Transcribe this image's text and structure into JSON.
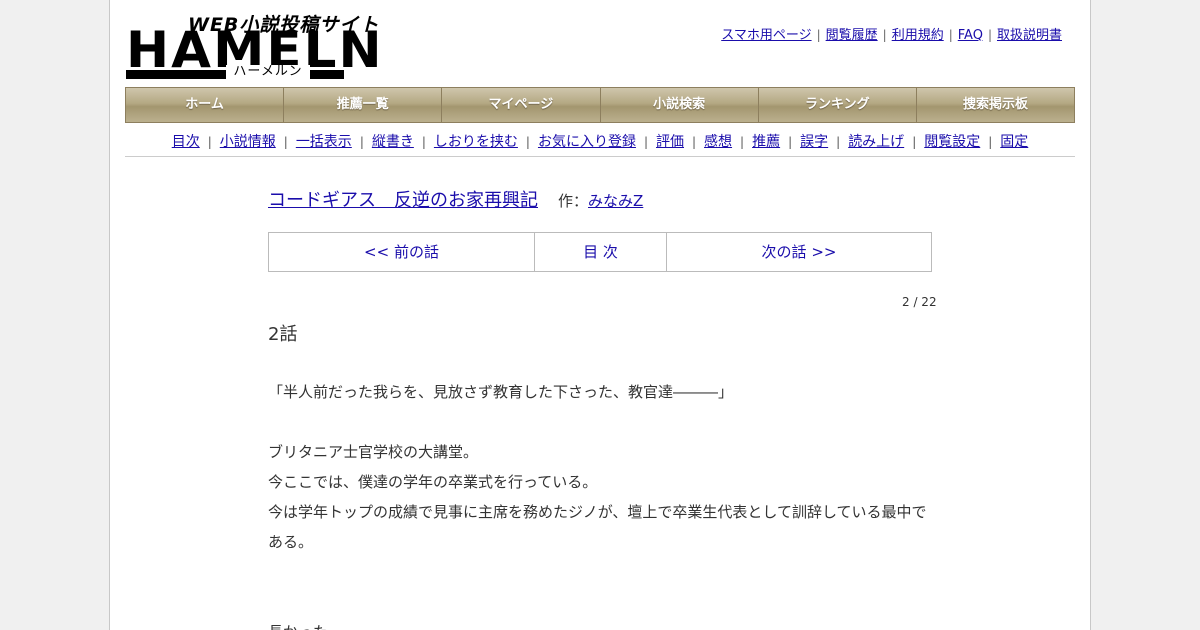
{
  "logo": {
    "tagline": "WEB小説投稿サイト",
    "wordmark": "HAMELN",
    "kana": "ハーメルン"
  },
  "toplinks": [
    "スマホ用ページ",
    "閲覧履歴",
    "利用規約",
    "FAQ",
    "取扱説明書"
  ],
  "nav": [
    "ホーム",
    "推薦一覧",
    "マイページ",
    "小説検索",
    "ランキング",
    "捜索掲示板"
  ],
  "subnav": [
    "目次",
    "小説情報",
    "一括表示",
    "縦書き",
    "しおりを挟む",
    "お気に入り登録",
    "評価",
    "感想",
    "推薦",
    "誤字",
    "読み上げ",
    "閲覧設定",
    "固定"
  ],
  "novel": {
    "title": "コードギアス　反逆のお家再興記",
    "author_label": "作：",
    "author": "みなみZ"
  },
  "pager": {
    "prev": "<< 前の話",
    "toc": "目 次",
    "next": "次の話 >>"
  },
  "page_counter": "2 / 22",
  "chapter_title": "2話",
  "body": [
    "「半人前だった我らを、見放さず教育した下さった、教官達―――」",
    "",
    "ブリタニア士官学校の大講堂。",
    "今ここでは、僕達の学年の卒業式を行っている。",
    "今は学年トップの成績で見事に主席を務めたジノが、壇上で卒業生代表として訓辞している最中である。",
    "",
    "",
    "長かった"
  ]
}
